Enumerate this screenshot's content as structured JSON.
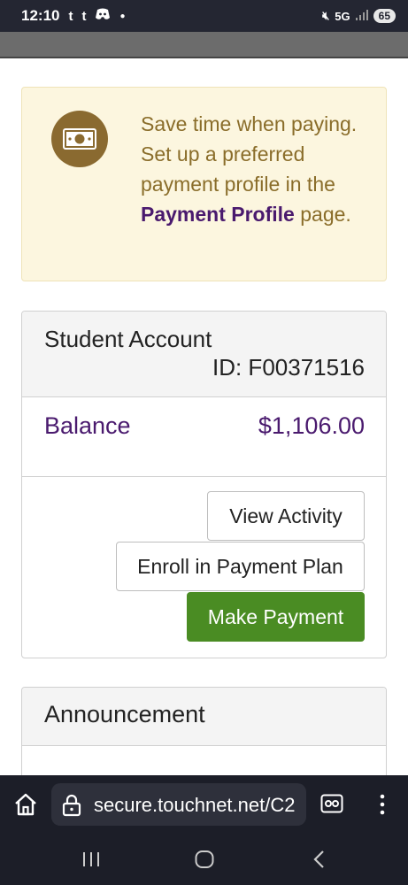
{
  "status": {
    "time": "12:10",
    "notif1": "t",
    "notif2": "t",
    "network": "5G",
    "battery": "65"
  },
  "promo": {
    "text": "Save time when paying. Set up a preferred payment profile in the",
    "link": "Payment Profile",
    "suffix": "page.",
    "icon": "money-icon"
  },
  "account": {
    "title": "Student Account",
    "id": "ID: F00371516",
    "balance_label": "Balance",
    "balance_value": "$1,106.00",
    "view_activity": "View Activity",
    "enroll_plan": "Enroll in Payment Plan",
    "make_payment": "Make Payment"
  },
  "announcement": {
    "title": "Announcement"
  },
  "browser": {
    "url": "secure.touchnet.net/C2"
  },
  "colors": {
    "accent_purple": "#4a1a6e",
    "pay_green": "#4a8c23",
    "promo_bg": "#fcf6df",
    "promo_text": "#8a6d2a"
  }
}
